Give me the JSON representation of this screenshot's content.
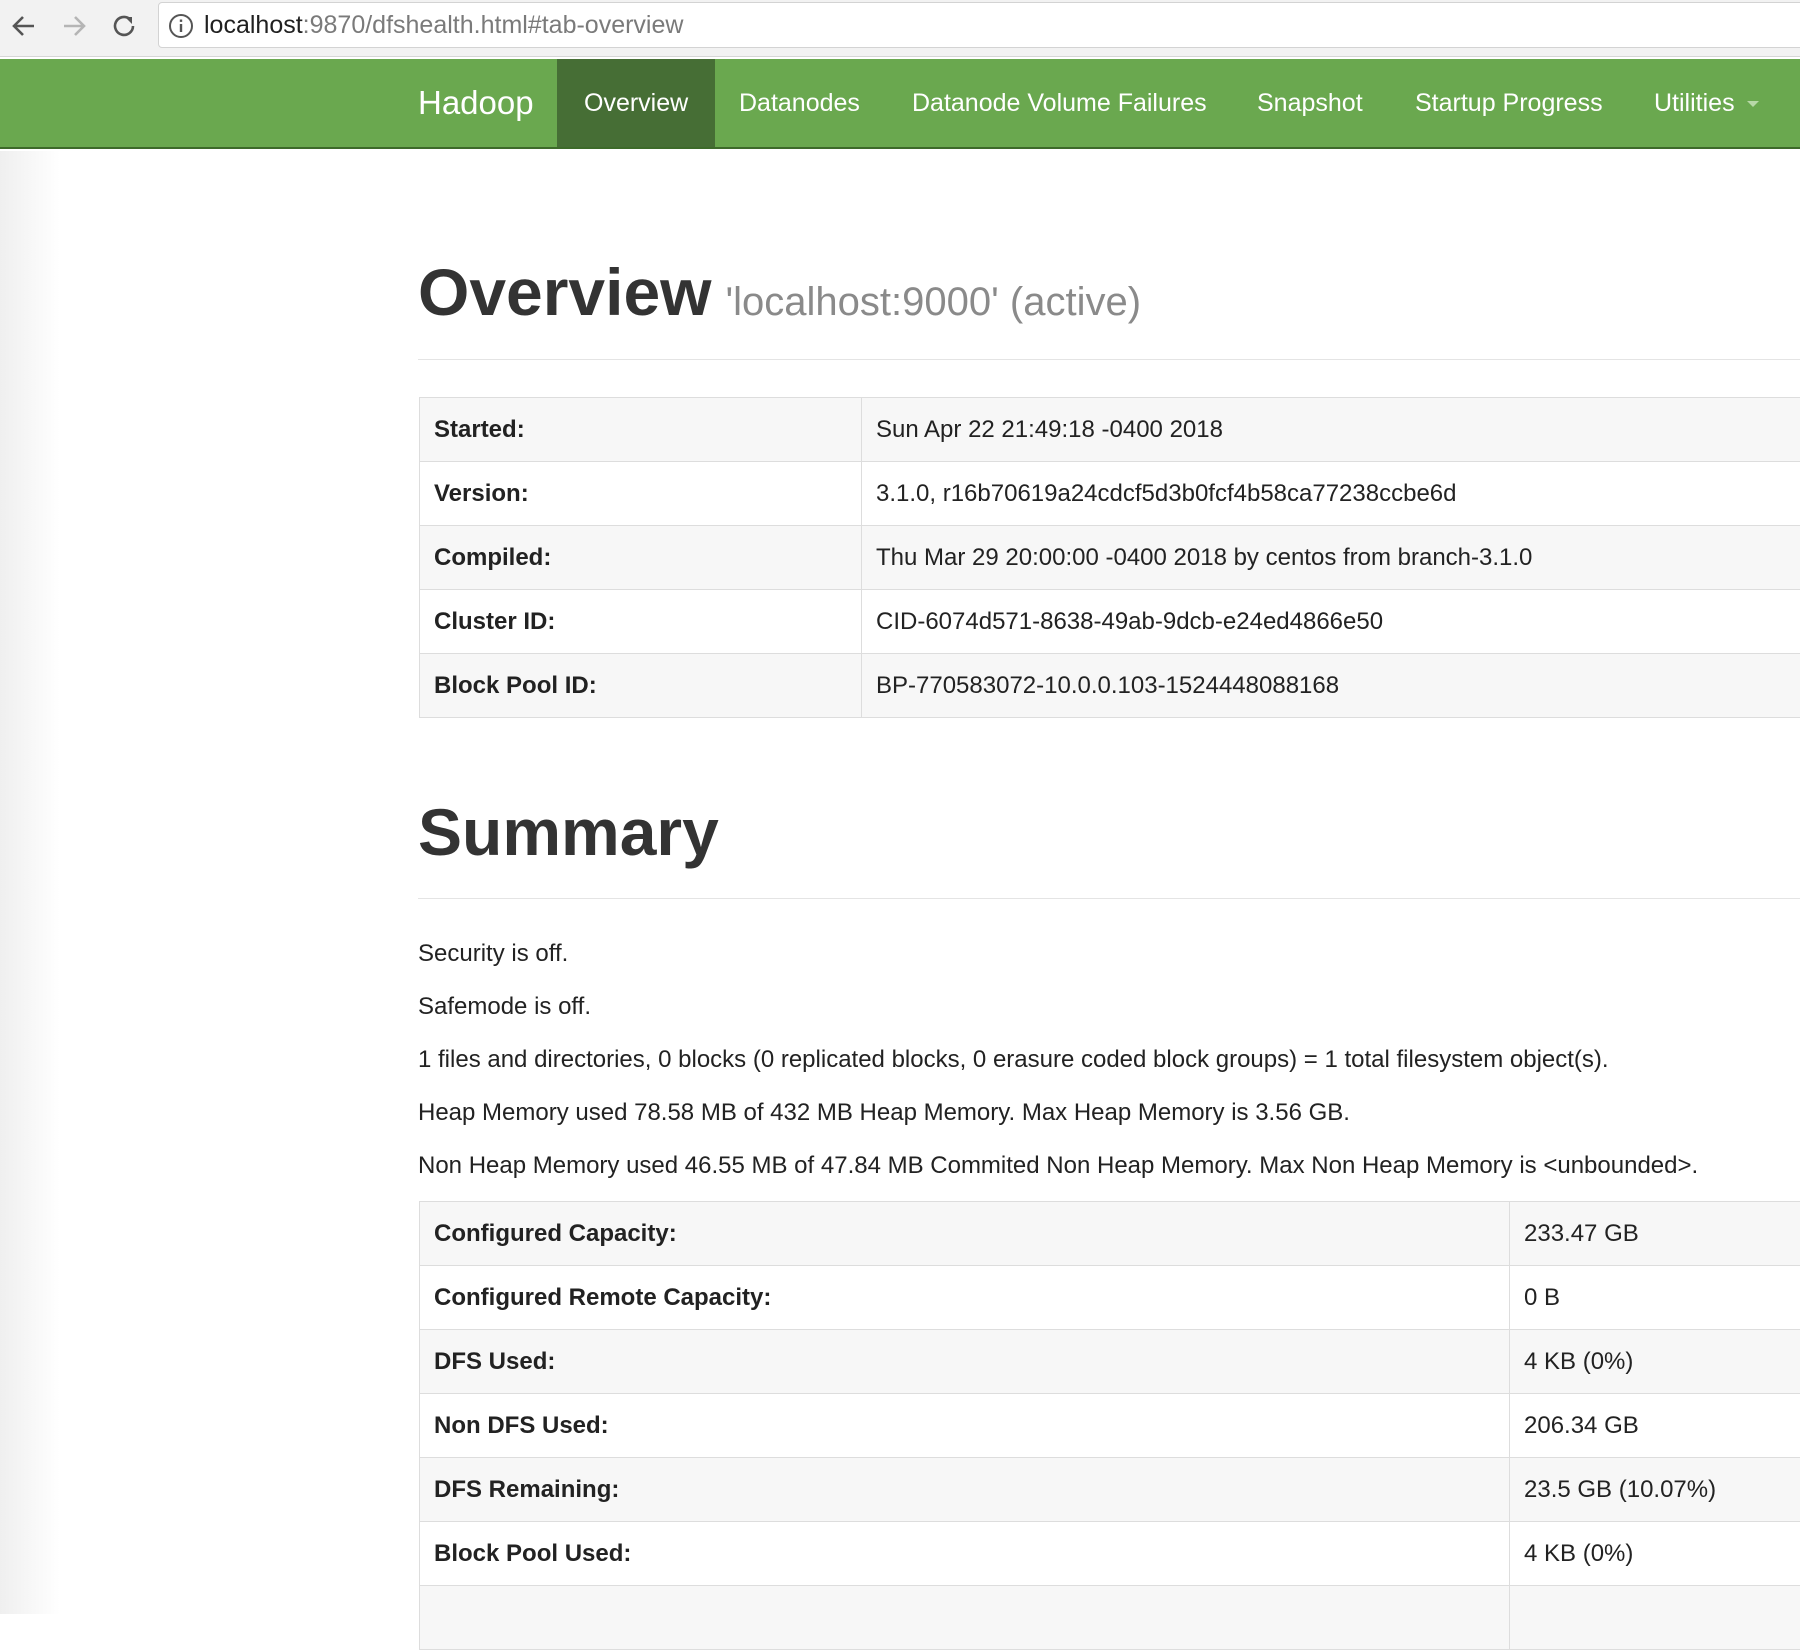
{
  "browser": {
    "url_host": "localhost",
    "url_rest": ":9870/dfshealth.html#tab-overview"
  },
  "navbar": {
    "brand": "Hadoop",
    "items": [
      {
        "label": "Overview",
        "active": true
      },
      {
        "label": "Datanodes"
      },
      {
        "label": "Datanode Volume Failures"
      },
      {
        "label": "Snapshot"
      },
      {
        "label": "Startup Progress"
      },
      {
        "label": "Utilities"
      }
    ],
    "colors": {
      "background": "#6aa84f",
      "active": "#466e35"
    }
  },
  "overview": {
    "title": "Overview",
    "subtitle": "'localhost:9000' (active)",
    "rows": [
      {
        "key": "Started:",
        "value": "Sun Apr 22 21:49:18 -0400 2018"
      },
      {
        "key": "Version:",
        "value": "3.1.0, r16b70619a24cdcf5d3b0fcf4b58ca77238ccbe6d"
      },
      {
        "key": "Compiled:",
        "value": "Thu Mar 29 20:00:00 -0400 2018 by centos from branch-3.1.0"
      },
      {
        "key": "Cluster ID:",
        "value": "CID-6074d571-8638-49ab-9dcb-e24ed4866e50"
      },
      {
        "key": "Block Pool ID:",
        "value": "BP-770583072-10.0.0.103-1524448088168"
      }
    ]
  },
  "summary": {
    "title": "Summary",
    "lines": [
      "Security is off.",
      "Safemode is off.",
      "1 files and directories, 0 blocks (0 replicated blocks, 0 erasure coded block groups) = 1 total filesystem object(s).",
      "Heap Memory used 78.58 MB of 432 MB Heap Memory. Max Heap Memory is 3.56 GB.",
      "Non Heap Memory used 46.55 MB of 47.84 MB Commited Non Heap Memory. Max Non Heap Memory is <unbounded>."
    ],
    "rows": [
      {
        "key": "Configured Capacity:",
        "value": "233.47 GB"
      },
      {
        "key": "Configured Remote Capacity:",
        "value": "0 B"
      },
      {
        "key": "DFS Used:",
        "value": "4 KB (0%)"
      },
      {
        "key": "Non DFS Used:",
        "value": "206.34 GB"
      },
      {
        "key": "DFS Remaining:",
        "value": "23.5 GB (10.07%)"
      },
      {
        "key": "Block Pool Used:",
        "value": "4 KB (0%)"
      }
    ]
  }
}
